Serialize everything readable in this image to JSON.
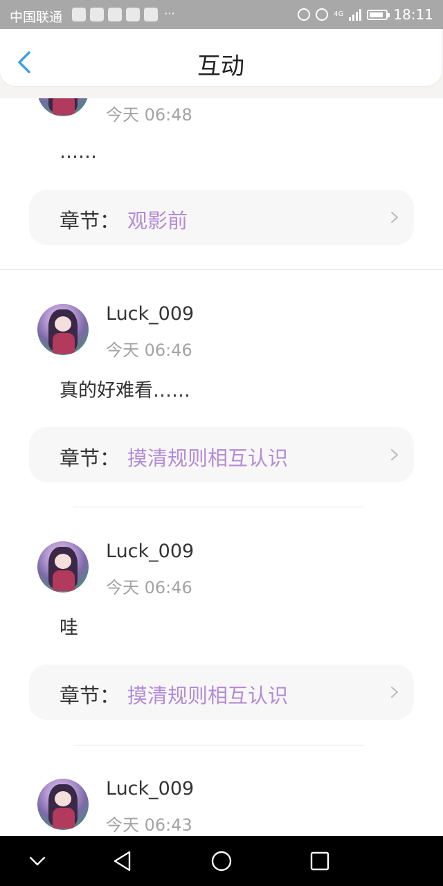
{
  "status_bar": {
    "carrier": "中国联通",
    "more": "···",
    "time": "18:11",
    "network": "4G"
  },
  "header": {
    "title": "互动"
  },
  "feed": [
    {
      "name": "",
      "time": "今天 06:48",
      "message": "……",
      "chapter_label": "章节：",
      "chapter_name": "观影前"
    },
    {
      "name": "Luck_009",
      "time": "今天 06:46",
      "message": "真的好难看……",
      "chapter_label": "章节：",
      "chapter_name": "摸清规则相互认识"
    },
    {
      "name": "Luck_009",
      "time": "今天 06:46",
      "message": "哇",
      "chapter_label": "章节：",
      "chapter_name": "摸清规则相互认识"
    },
    {
      "name": "Luck_009",
      "time": "今天 06:43"
    }
  ],
  "nav_bar": {
    "icons": [
      "chevron-down-icon",
      "back-triangle-icon",
      "home-circle-icon",
      "recents-square-icon"
    ]
  },
  "colors": {
    "chapter_accent": "#b48bd6",
    "back_arrow": "#3d9fe8",
    "status_bar_bg": "#a8a8a8"
  }
}
